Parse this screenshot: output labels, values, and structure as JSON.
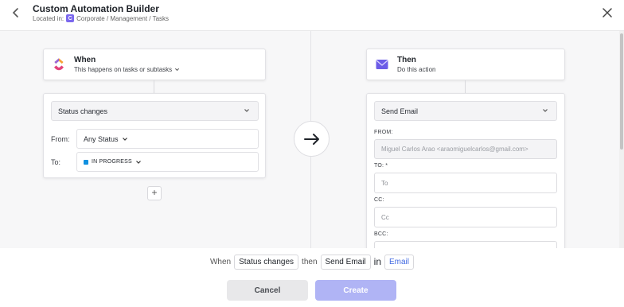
{
  "header": {
    "title": "Custom Automation Builder",
    "located_prefix": "Located in:",
    "location_badge": "C",
    "location_path": "Corporate / Management / Tasks",
    "back_icon": "chevron-left-icon",
    "close_icon": "close-icon"
  },
  "trigger": {
    "title": "When",
    "subtitle": "This happens on tasks or subtasks",
    "select_value": "Status changes",
    "from_label": "From:",
    "from_value": "Any Status",
    "to_label": "To:",
    "to_value": "IN PROGRESS",
    "to_color": "#1090e0",
    "add_label": "+"
  },
  "action": {
    "title": "Then",
    "subtitle": "Do this action",
    "select_value": "Send Email",
    "from_label": "FROM:",
    "from_value": "Miguel Carlos Arao <araomiguelcarlos@gmail.com>",
    "to_label": "TO: *",
    "to_placeholder": "To",
    "cc_label": "CC:",
    "cc_placeholder": "Cc",
    "bcc_label": "BCC:"
  },
  "summary": {
    "when": "When",
    "trigger_chip": "Status changes",
    "then": "then",
    "action_chip": "Send Email",
    "in": "in",
    "channel_chip": "Email"
  },
  "footer": {
    "cancel_label": "Cancel",
    "create_label": "Create"
  },
  "colors": {
    "accent": "#7b68ee",
    "create_disabled": "#b0b4f5",
    "link": "#4169e1"
  }
}
